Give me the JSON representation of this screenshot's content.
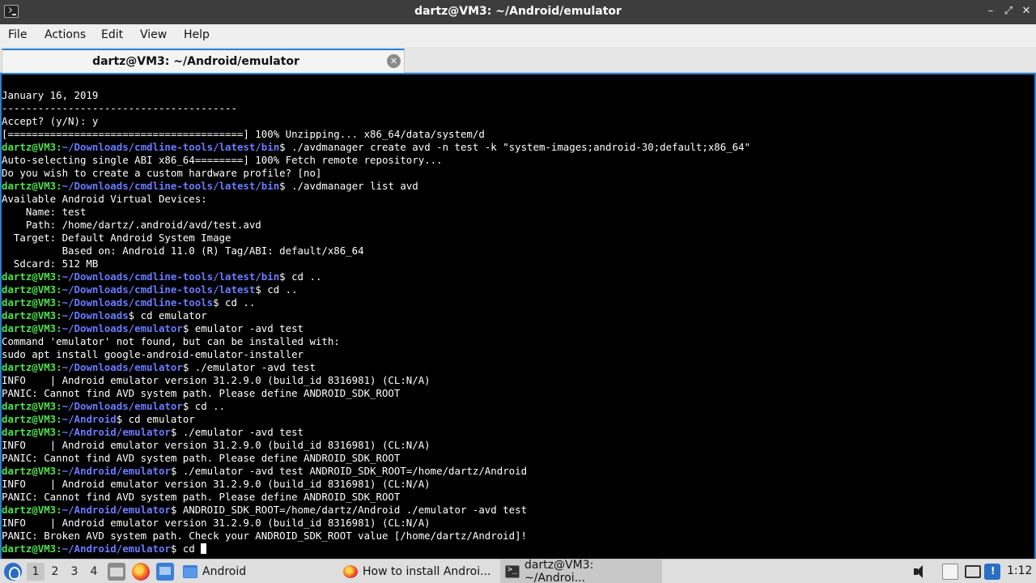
{
  "window": {
    "title": "dartz@VM3: ~/Android/emulator"
  },
  "menu": {
    "items": [
      "File",
      "Actions",
      "Edit",
      "View",
      "Help"
    ]
  },
  "tab": {
    "label": "dartz@VM3: ~/Android/emulator"
  },
  "terminal": {
    "lines": [
      {
        "t": "January 16, 2019"
      },
      {
        "t": "---------------------------------------"
      },
      {
        "t": "Accept? (y/N): y"
      },
      {
        "t": "[=======================================] 100% Unzipping... x86_64/data/system/d"
      },
      {
        "u": "dartz@VM3",
        "p": "~/Downloads/cmdline-tools/latest/bin",
        "c": " ./avdmanager create avd -n test -k \"system-images;android-30;default;x86_64\""
      },
      {
        "t": "Auto-selecting single ABI x86_64========] 100% Fetch remote repository..."
      },
      {
        "t": "Do you wish to create a custom hardware profile? [no]"
      },
      {
        "u": "dartz@VM3",
        "p": "~/Downloads/cmdline-tools/latest/bin",
        "c": " ./avdmanager list avd"
      },
      {
        "t": "Available Android Virtual Devices:"
      },
      {
        "t": "    Name: test"
      },
      {
        "t": "    Path: /home/dartz/.android/avd/test.avd"
      },
      {
        "t": "  Target: Default Android System Image"
      },
      {
        "t": "          Based on: Android 11.0 (R) Tag/ABI: default/x86_64"
      },
      {
        "t": "  Sdcard: 512 MB"
      },
      {
        "u": "dartz@VM3",
        "p": "~/Downloads/cmdline-tools/latest/bin",
        "c": " cd .."
      },
      {
        "u": "dartz@VM3",
        "p": "~/Downloads/cmdline-tools/latest",
        "c": " cd .."
      },
      {
        "u": "dartz@VM3",
        "p": "~/Downloads/cmdline-tools",
        "c": " cd .."
      },
      {
        "u": "dartz@VM3",
        "p": "~/Downloads",
        "c": " cd emulator"
      },
      {
        "u": "dartz@VM3",
        "p": "~/Downloads/emulator",
        "c": " emulator -avd test"
      },
      {
        "t": "Command 'emulator' not found, but can be installed with:"
      },
      {
        "t": "sudo apt install google-android-emulator-installer"
      },
      {
        "u": "dartz@VM3",
        "p": "~/Downloads/emulator",
        "c": " ./emulator -avd test"
      },
      {
        "t": "INFO    | Android emulator version 31.2.9.0 (build_id 8316981) (CL:N/A)"
      },
      {
        "t": "PANIC: Cannot find AVD system path. Please define ANDROID_SDK_ROOT"
      },
      {
        "u": "dartz@VM3",
        "p": "~/Downloads/emulator",
        "c": " cd .."
      },
      {
        "u": "dartz@VM3",
        "p": "~/Android",
        "c": " cd emulator"
      },
      {
        "u": "dartz@VM3",
        "p": "~/Android/emulator",
        "c": " ./emulator -avd test"
      },
      {
        "t": "INFO    | Android emulator version 31.2.9.0 (build_id 8316981) (CL:N/A)"
      },
      {
        "t": "PANIC: Cannot find AVD system path. Please define ANDROID_SDK_ROOT"
      },
      {
        "u": "dartz@VM3",
        "p": "~/Android/emulator",
        "c": " ./emulator -avd test ANDROID_SDK_ROOT=/home/dartz/Android"
      },
      {
        "t": "INFO    | Android emulator version 31.2.9.0 (build_id 8316981) (CL:N/A)"
      },
      {
        "t": "PANIC: Cannot find AVD system path. Please define ANDROID_SDK_ROOT"
      },
      {
        "u": "dartz@VM3",
        "p": "~/Android/emulator",
        "c": " ANDROID_SDK_ROOT=/home/dartz/Android ./emulator -avd test"
      },
      {
        "t": "INFO    | Android emulator version 31.2.9.0 (build_id 8316981) (CL:N/A)"
      },
      {
        "t": "PANIC: Broken AVD system path. Check your ANDROID_SDK_ROOT value [/home/dartz/Android]!"
      },
      {
        "u": "dartz@VM3",
        "p": "~/Android/emulator",
        "c": " cd ",
        "cursor": true
      }
    ]
  },
  "taskbar": {
    "workspaces": [
      "1",
      "2",
      "3",
      "4"
    ],
    "active_workspace": "1",
    "tasks": [
      {
        "label": "Android",
        "icon": "folder-icon"
      },
      {
        "label": "How to install Androi...",
        "icon": "firefox-icon"
      },
      {
        "label": "dartz@VM3: ~/Androi...",
        "icon": "terminal-icon",
        "active": true
      }
    ],
    "clock": "1:12"
  },
  "colors": {
    "prompt_user": "#4fe04f",
    "prompt_path": "#6b7bff",
    "accent": "#2a7fd4",
    "terminal_bg": "#000000"
  }
}
